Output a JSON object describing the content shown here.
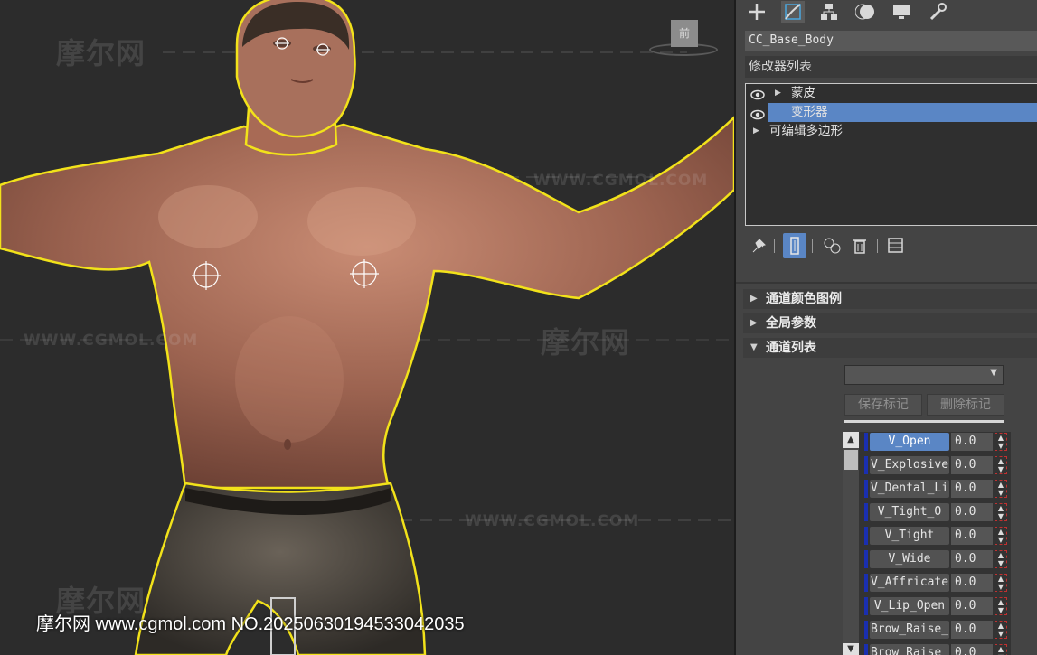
{
  "viewport": {
    "nav_cube_label": "前",
    "watermarks": [
      "摩尔网",
      "WWW.CGMOL.COM",
      "WWW.CGMOL.COM",
      "摩尔网",
      "WWW.CGMOL.COM",
      "摩尔网",
      "WWW.CGMOL.COM"
    ],
    "footer_text": "摩尔网 www.cgmol.com NO.20250630194533042035"
  },
  "toolbar": {
    "icons": [
      "create-icon",
      "modify-icon",
      "hierarchy-icon",
      "motion-icon",
      "display-icon",
      "utilities-icon"
    ],
    "active": "modify-icon"
  },
  "object_name": "CC_Base_Body",
  "modifier_list_label": "修改器列表",
  "stack": {
    "items": [
      {
        "label": "蒙皮",
        "visible": true,
        "expandable": true,
        "selected": false
      },
      {
        "label": "变形器",
        "visible": true,
        "expandable": false,
        "selected": true
      },
      {
        "label": "可编辑多边形",
        "visible": false,
        "expandable": true,
        "selected": false
      }
    ]
  },
  "stack_buttons": [
    "pin-stack-icon",
    "show-end-result-icon",
    "make-unique-icon",
    "remove-modifier-icon",
    "configure-sets-icon"
  ],
  "rollouts": [
    {
      "label": "通道颜色图例",
      "expanded": false
    },
    {
      "label": "全局参数",
      "expanded": false
    },
    {
      "label": "通道列表",
      "expanded": true
    }
  ],
  "channel_list": {
    "dropdown_value": "",
    "save_marker": "保存标记",
    "delete_marker": "删除标记",
    "channels": [
      {
        "name": "V_Open",
        "value": "0.0",
        "active": true
      },
      {
        "name": "V_Explosive",
        "value": "0.0",
        "active": false
      },
      {
        "name": "V_Dental_Li",
        "value": "0.0",
        "active": false
      },
      {
        "name": "V_Tight_O",
        "value": "0.0",
        "active": false
      },
      {
        "name": "V_Tight",
        "value": "0.0",
        "active": false
      },
      {
        "name": "V_Wide",
        "value": "0.0",
        "active": false
      },
      {
        "name": "V_Affricate",
        "value": "0.0",
        "active": false
      },
      {
        "name": "V_Lip_Open",
        "value": "0.0",
        "active": false
      },
      {
        "name": "Brow_Raise_",
        "value": "0.0",
        "active": false
      },
      {
        "name": "Brow_Raise_",
        "value": "0.0",
        "active": false
      }
    ]
  },
  "colors": {
    "selection_outline": "#f2e21a",
    "selected_blue": "#5a86c5",
    "channel_marker": "#1a2fb0"
  }
}
